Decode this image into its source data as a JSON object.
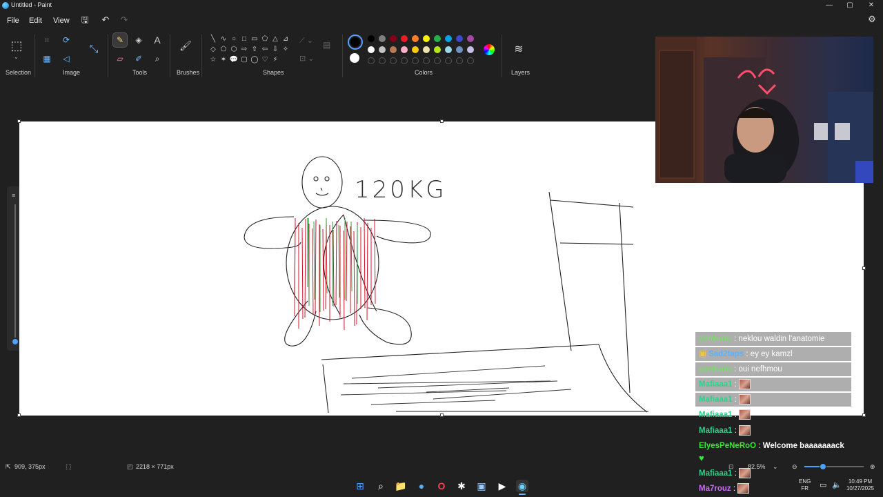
{
  "window": {
    "title": "Untitled - Paint",
    "min": "—",
    "max": "▢",
    "close": "✕"
  },
  "menu": {
    "file": "File",
    "edit": "Edit",
    "view": "View"
  },
  "quick_access": {
    "save": "🖫",
    "undo": "↶",
    "redo": "↷"
  },
  "settings_icon": "⚙",
  "ribbon": {
    "groups": {
      "selection": "Selection",
      "image": "Image",
      "tools": "Tools",
      "brushes": "Brushes",
      "shapes": "Shapes",
      "colors": "Colors",
      "layers": "Layers"
    },
    "icons": {
      "selection": "⬚",
      "crop": "⌗",
      "rotate": "⟳",
      "resize": "⤡",
      "background": "▦",
      "image_alt": "◁",
      "pencil": "✎",
      "fill": "◈",
      "text": "A",
      "eraser": "▱",
      "picker": "✐",
      "magnifier": "⌕",
      "brush": "🖌",
      "layers": "≋"
    },
    "shapes": [
      "╲",
      "∿",
      "○",
      "□",
      "▭",
      "⬠",
      "△",
      "⊿",
      "◇",
      "⬠",
      "⬡",
      "⇨",
      "⇧",
      "⇦",
      "⇩",
      "✧",
      "☆",
      "✶",
      "💬",
      "▢",
      "◯",
      "♡",
      "⚡"
    ],
    "colors": {
      "selected": "#000000",
      "row1": [
        "#000000",
        "#7f7f7f",
        "#880015",
        "#ed1c24",
        "#ff7f27",
        "#fff200",
        "#22b14c",
        "#00a2e8",
        "#3f48cc",
        "#a349a4"
      ],
      "row2": [
        "#ffffff",
        "#c3c3c3",
        "#b97a57",
        "#ffaec9",
        "#ffc90e",
        "#efe4b0",
        "#b5e61d",
        "#99d9ea",
        "#7092be",
        "#c8bfe7"
      ]
    }
  },
  "canvas": {
    "drawing_text": "120KG"
  },
  "chat": [
    {
      "user": "yonkuuu",
      "color": "#7bd96b",
      "msg": "neklou waldin l'anatomie",
      "emote": false,
      "bg": true
    },
    {
      "user": "Sad2taps",
      "color": "#5ab0ff",
      "msg": "ey ey kamzl",
      "emote": false,
      "bg": true,
      "badge": true
    },
    {
      "user": "yonkuuu",
      "color": "#7bd96b",
      "msg": "oui nefhmou",
      "emote": false,
      "bg": true
    },
    {
      "user": "Mafiaaa1",
      "color": "#2fd08a",
      "msg": "",
      "emote": true,
      "bg": true
    },
    {
      "user": "Mafiaaa1",
      "color": "#2fd08a",
      "msg": "",
      "emote": true,
      "bg": true
    },
    {
      "user": "Mafiaaa1",
      "color": "#2fd08a",
      "msg": "",
      "emote": true,
      "bg": false
    },
    {
      "user": "Mafiaaa1",
      "color": "#2fd08a",
      "msg": "",
      "emote": true,
      "bg": false
    },
    {
      "user": "ElyesPeNeRoO",
      "color": "#39e639",
      "msg": "Welcome baaaaaaack",
      "emote": false,
      "bg": false
    },
    {
      "user": "Mafiaaa1",
      "color": "#2fd08a",
      "msg": "",
      "emote": true,
      "bg": false
    },
    {
      "user": "Ma7rouz",
      "color": "#c86bff",
      "msg": "",
      "emote": true,
      "bg": false
    }
  ],
  "chat_heart": "♥",
  "status": {
    "cursor_pos": "909, 375px",
    "canvas_size": "2218 × 771px",
    "zoom": "82.5%",
    "zoom_level": 0.3
  },
  "system": {
    "lang1": "ENG",
    "lang2": "FR",
    "time": "10:49 PM",
    "date": "10/27/2025"
  },
  "taskbar": {
    "start": "⊞",
    "search": "⌕",
    "explorer": "📁",
    "app1": "●",
    "opera": "O",
    "chatgpt": "✱",
    "app2": "▣",
    "media": "▶",
    "paint": "◉"
  }
}
